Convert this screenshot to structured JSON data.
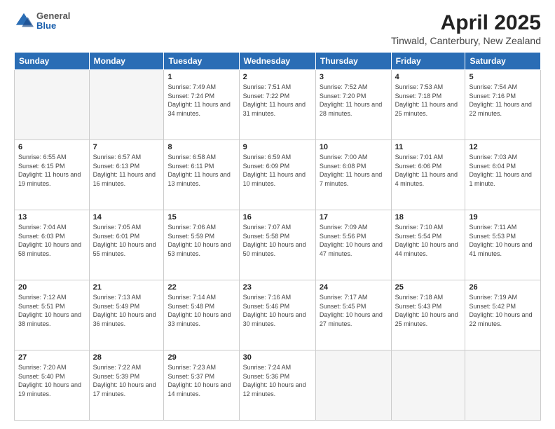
{
  "header": {
    "logo": {
      "general": "General",
      "blue": "Blue"
    },
    "title": "April 2025",
    "subtitle": "Tinwald, Canterbury, New Zealand"
  },
  "weekdays": [
    "Sunday",
    "Monday",
    "Tuesday",
    "Wednesday",
    "Thursday",
    "Friday",
    "Saturday"
  ],
  "weeks": [
    [
      {
        "day": "",
        "sunrise": "",
        "sunset": "",
        "daylight": ""
      },
      {
        "day": "",
        "sunrise": "",
        "sunset": "",
        "daylight": ""
      },
      {
        "day": "1",
        "sunrise": "Sunrise: 7:49 AM",
        "sunset": "Sunset: 7:24 PM",
        "daylight": "Daylight: 11 hours and 34 minutes."
      },
      {
        "day": "2",
        "sunrise": "Sunrise: 7:51 AM",
        "sunset": "Sunset: 7:22 PM",
        "daylight": "Daylight: 11 hours and 31 minutes."
      },
      {
        "day": "3",
        "sunrise": "Sunrise: 7:52 AM",
        "sunset": "Sunset: 7:20 PM",
        "daylight": "Daylight: 11 hours and 28 minutes."
      },
      {
        "day": "4",
        "sunrise": "Sunrise: 7:53 AM",
        "sunset": "Sunset: 7:18 PM",
        "daylight": "Daylight: 11 hours and 25 minutes."
      },
      {
        "day": "5",
        "sunrise": "Sunrise: 7:54 AM",
        "sunset": "Sunset: 7:16 PM",
        "daylight": "Daylight: 11 hours and 22 minutes."
      }
    ],
    [
      {
        "day": "6",
        "sunrise": "Sunrise: 6:55 AM",
        "sunset": "Sunset: 6:15 PM",
        "daylight": "Daylight: 11 hours and 19 minutes."
      },
      {
        "day": "7",
        "sunrise": "Sunrise: 6:57 AM",
        "sunset": "Sunset: 6:13 PM",
        "daylight": "Daylight: 11 hours and 16 minutes."
      },
      {
        "day": "8",
        "sunrise": "Sunrise: 6:58 AM",
        "sunset": "Sunset: 6:11 PM",
        "daylight": "Daylight: 11 hours and 13 minutes."
      },
      {
        "day": "9",
        "sunrise": "Sunrise: 6:59 AM",
        "sunset": "Sunset: 6:09 PM",
        "daylight": "Daylight: 11 hours and 10 minutes."
      },
      {
        "day": "10",
        "sunrise": "Sunrise: 7:00 AM",
        "sunset": "Sunset: 6:08 PM",
        "daylight": "Daylight: 11 hours and 7 minutes."
      },
      {
        "day": "11",
        "sunrise": "Sunrise: 7:01 AM",
        "sunset": "Sunset: 6:06 PM",
        "daylight": "Daylight: 11 hours and 4 minutes."
      },
      {
        "day": "12",
        "sunrise": "Sunrise: 7:03 AM",
        "sunset": "Sunset: 6:04 PM",
        "daylight": "Daylight: 11 hours and 1 minute."
      }
    ],
    [
      {
        "day": "13",
        "sunrise": "Sunrise: 7:04 AM",
        "sunset": "Sunset: 6:03 PM",
        "daylight": "Daylight: 10 hours and 58 minutes."
      },
      {
        "day": "14",
        "sunrise": "Sunrise: 7:05 AM",
        "sunset": "Sunset: 6:01 PM",
        "daylight": "Daylight: 10 hours and 55 minutes."
      },
      {
        "day": "15",
        "sunrise": "Sunrise: 7:06 AM",
        "sunset": "Sunset: 5:59 PM",
        "daylight": "Daylight: 10 hours and 53 minutes."
      },
      {
        "day": "16",
        "sunrise": "Sunrise: 7:07 AM",
        "sunset": "Sunset: 5:58 PM",
        "daylight": "Daylight: 10 hours and 50 minutes."
      },
      {
        "day": "17",
        "sunrise": "Sunrise: 7:09 AM",
        "sunset": "Sunset: 5:56 PM",
        "daylight": "Daylight: 10 hours and 47 minutes."
      },
      {
        "day": "18",
        "sunrise": "Sunrise: 7:10 AM",
        "sunset": "Sunset: 5:54 PM",
        "daylight": "Daylight: 10 hours and 44 minutes."
      },
      {
        "day": "19",
        "sunrise": "Sunrise: 7:11 AM",
        "sunset": "Sunset: 5:53 PM",
        "daylight": "Daylight: 10 hours and 41 minutes."
      }
    ],
    [
      {
        "day": "20",
        "sunrise": "Sunrise: 7:12 AM",
        "sunset": "Sunset: 5:51 PM",
        "daylight": "Daylight: 10 hours and 38 minutes."
      },
      {
        "day": "21",
        "sunrise": "Sunrise: 7:13 AM",
        "sunset": "Sunset: 5:49 PM",
        "daylight": "Daylight: 10 hours and 36 minutes."
      },
      {
        "day": "22",
        "sunrise": "Sunrise: 7:14 AM",
        "sunset": "Sunset: 5:48 PM",
        "daylight": "Daylight: 10 hours and 33 minutes."
      },
      {
        "day": "23",
        "sunrise": "Sunrise: 7:16 AM",
        "sunset": "Sunset: 5:46 PM",
        "daylight": "Daylight: 10 hours and 30 minutes."
      },
      {
        "day": "24",
        "sunrise": "Sunrise: 7:17 AM",
        "sunset": "Sunset: 5:45 PM",
        "daylight": "Daylight: 10 hours and 27 minutes."
      },
      {
        "day": "25",
        "sunrise": "Sunrise: 7:18 AM",
        "sunset": "Sunset: 5:43 PM",
        "daylight": "Daylight: 10 hours and 25 minutes."
      },
      {
        "day": "26",
        "sunrise": "Sunrise: 7:19 AM",
        "sunset": "Sunset: 5:42 PM",
        "daylight": "Daylight: 10 hours and 22 minutes."
      }
    ],
    [
      {
        "day": "27",
        "sunrise": "Sunrise: 7:20 AM",
        "sunset": "Sunset: 5:40 PM",
        "daylight": "Daylight: 10 hours and 19 minutes."
      },
      {
        "day": "28",
        "sunrise": "Sunrise: 7:22 AM",
        "sunset": "Sunset: 5:39 PM",
        "daylight": "Daylight: 10 hours and 17 minutes."
      },
      {
        "day": "29",
        "sunrise": "Sunrise: 7:23 AM",
        "sunset": "Sunset: 5:37 PM",
        "daylight": "Daylight: 10 hours and 14 minutes."
      },
      {
        "day": "30",
        "sunrise": "Sunrise: 7:24 AM",
        "sunset": "Sunset: 5:36 PM",
        "daylight": "Daylight: 10 hours and 12 minutes."
      },
      {
        "day": "",
        "sunrise": "",
        "sunset": "",
        "daylight": ""
      },
      {
        "day": "",
        "sunrise": "",
        "sunset": "",
        "daylight": ""
      },
      {
        "day": "",
        "sunrise": "",
        "sunset": "",
        "daylight": ""
      }
    ]
  ]
}
